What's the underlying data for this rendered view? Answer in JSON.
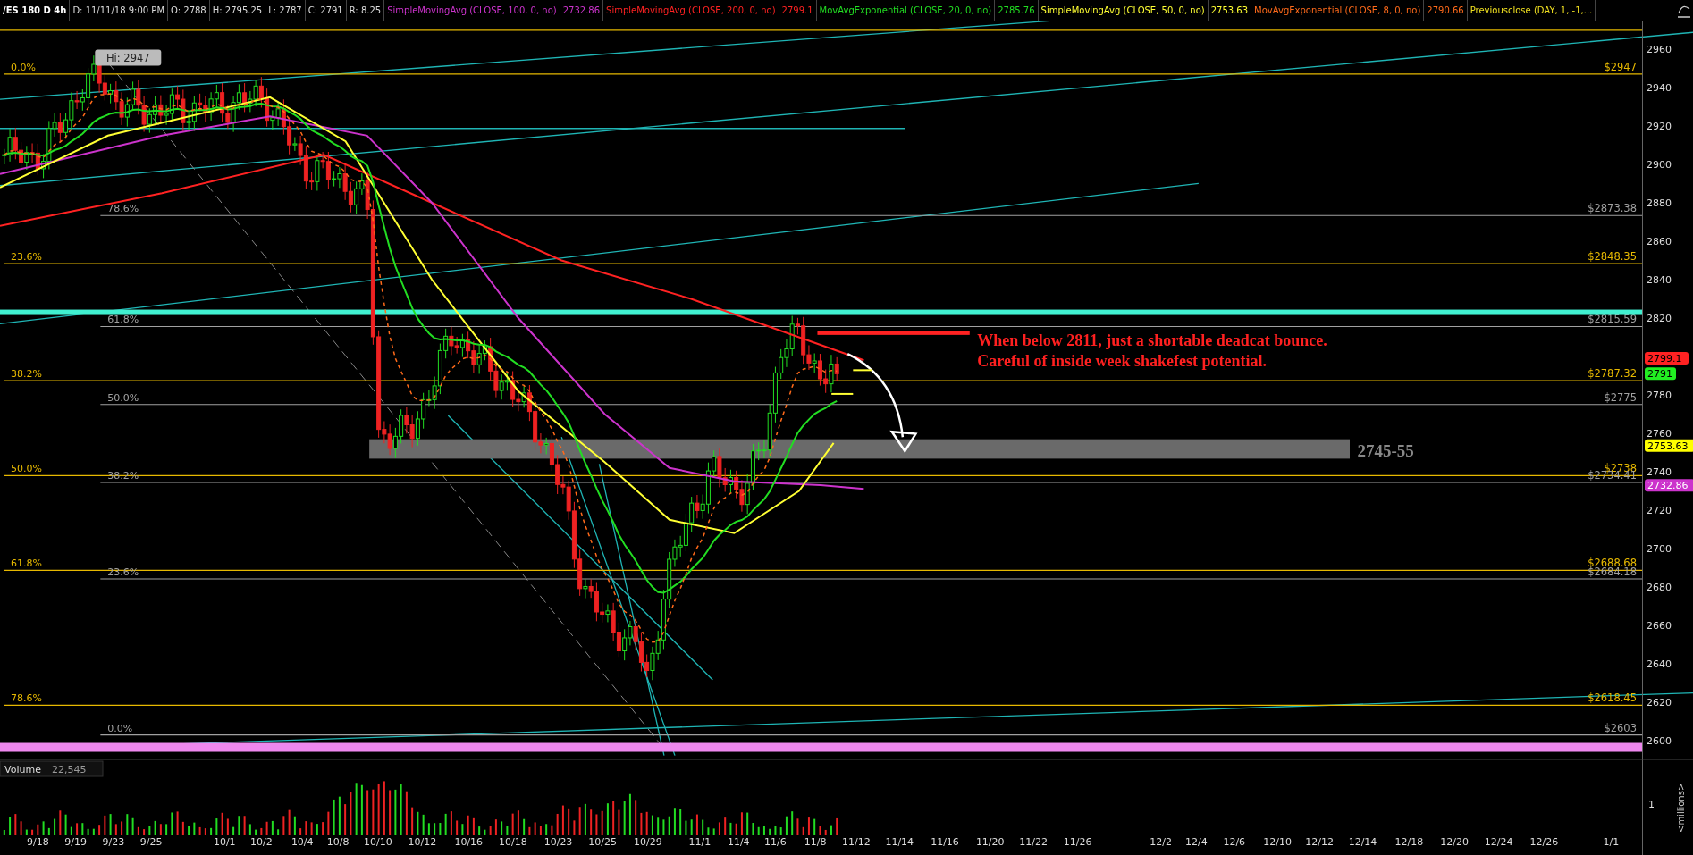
{
  "header": {
    "symbol": "/ES 180 D 4h",
    "fields": [
      "D: 11/11/18 9:00 PM",
      "O: 2788",
      "H: 2795.25",
      "L: 2787",
      "C: 2791",
      "R: 8.25"
    ],
    "studies": [
      {
        "name": "SimpleMovingAvg (CLOSE, 100, 0, no)",
        "value": "2732.86",
        "color": "#cc33cc"
      },
      {
        "name": "SimpleMovingAvg (CLOSE, 200, 0, no)",
        "value": "2799.1",
        "color": "#ff2222"
      },
      {
        "name": "MovAvgExponential (CLOSE, 20, 0, no)",
        "value": "2785.76",
        "color": "#22dd22"
      },
      {
        "name": "SimpleMovingAvg (CLOSE, 50, 0, no)",
        "value": "2753.63",
        "color": "#ffff33"
      },
      {
        "name": "MovAvgExponential (CLOSE, 8, 0, no)",
        "value": "2790.66",
        "color": "#ff6a1a"
      },
      {
        "name": "Previousclose (DAY, 1, -1,...",
        "color": "#f0e020"
      }
    ]
  },
  "high_tag": "Hi: 2947",
  "fib_sets": [
    {
      "color": "#e6b800",
      "levels": [
        {
          "pct": "0.0%",
          "price": "$2947"
        },
        {
          "pct": "23.6%",
          "price": "$2848.35"
        },
        {
          "pct": "38.2%",
          "price": "$2787.32"
        },
        {
          "pct": "50.0%",
          "price": "$2738"
        },
        {
          "pct": "61.8%",
          "price": "$2688.68"
        },
        {
          "pct": "78.6%",
          "price": "$2618.45"
        }
      ]
    },
    {
      "color": "#a0a0a0",
      "levels": [
        {
          "pct": "78.6%",
          "price": "$2873.38"
        },
        {
          "pct": "61.8%",
          "price": "$2815.59"
        },
        {
          "pct": "50.0%",
          "price": "$2775"
        },
        {
          "pct": "38.2%",
          "price": "$2734.41"
        },
        {
          "pct": "23.6%",
          "price": "$2684.18"
        },
        {
          "pct": "0.0%",
          "price": "$2603"
        }
      ]
    }
  ],
  "annotation": [
    "When below 2811, just a shortable deadcat bounce.",
    "Careful of inside week shakefest potential."
  ],
  "zone_label": "2745-55",
  "price_axis": {
    "ticks": [
      "2960",
      "2940",
      "2920",
      "2900",
      "2880",
      "2860",
      "2840",
      "2820",
      "2780",
      "2760",
      "2740",
      "2720",
      "2700",
      "2680",
      "2660",
      "2640",
      "2620",
      "2600"
    ],
    "markers": [
      {
        "text": "2799.1",
        "color": "#ff2222"
      },
      {
        "text": "2791",
        "color": "#22ee22"
      },
      {
        "text": "2753.63",
        "color": "#ffff00"
      },
      {
        "text": "2732.86",
        "color": "#cc33cc"
      }
    ]
  },
  "volume": {
    "label": "Volume",
    "value": "22,545",
    "tick": "1",
    "unit": "<millions>"
  },
  "dates": [
    "9/18",
    "9/19",
    "9/23",
    "9/25",
    "10/1",
    "10/2",
    "10/4",
    "10/8",
    "10/10",
    "10/12",
    "10/16",
    "10/18",
    "10/23",
    "10/25",
    "10/29",
    "11/1",
    "11/4",
    "11/6",
    "11/8",
    "11/12",
    "11/14",
    "11/16",
    "11/20",
    "11/22",
    "11/26",
    "12/2",
    "12/4",
    "12/6",
    "12/10",
    "12/12",
    "12/14",
    "12/18",
    "12/20",
    "12/24",
    "12/26",
    "1/1"
  ]
}
